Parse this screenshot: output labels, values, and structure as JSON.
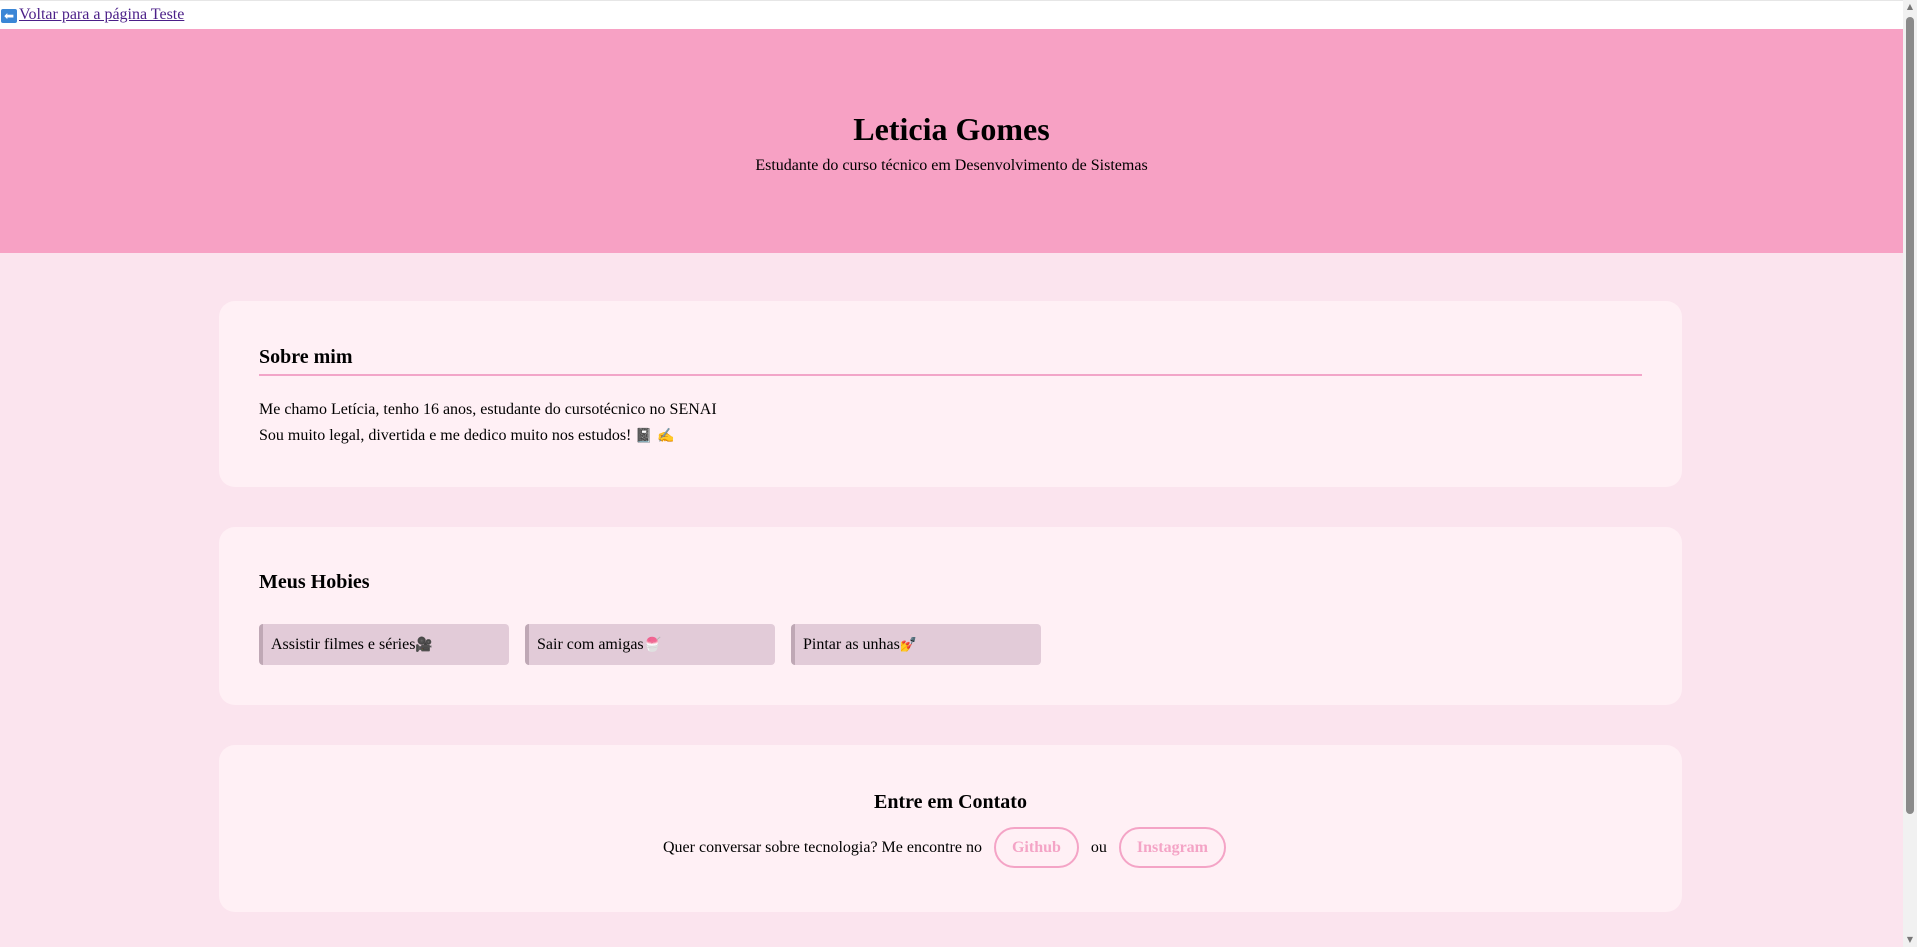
{
  "nav": {
    "back_icon": "arrow-left-icon",
    "back_label": "Voltar para a página Teste"
  },
  "header": {
    "name": "Leticia Gomes",
    "subtitle": "Estudante do curso técnico em Desenvolvimento de Sistemas",
    "background": "#f7a1c4"
  },
  "about": {
    "title": "Sobre mim",
    "line1": "Me chamo Letícia, tenho 16 anos, estudante do cursotécnico no SENAI",
    "line2": "Sou muito legal, divertida e me dedico muito nos estudos! ",
    "emojis": "📓 ✍️"
  },
  "hobbies": {
    "title": "Meus Hobies",
    "items": [
      {
        "label": "Assistir filmes e séries",
        "emoji": "🎥"
      },
      {
        "label": "Sair com amigas",
        "emoji": "🍧"
      },
      {
        "label": "Pintar as unhas",
        "emoji": "💅"
      }
    ]
  },
  "contact": {
    "title": "Entre em Contato",
    "text": "Quer conversar sobre tecnologia? Me encontre no",
    "github_label": "Github",
    "separator": "ou",
    "instagram_label": "Instagram",
    "accent": "#f4a4c6"
  },
  "colors": {
    "page_bg": "#fbe4ee",
    "card_bg": "#fff0f5",
    "hobby_bg": "#e2cbd8"
  }
}
